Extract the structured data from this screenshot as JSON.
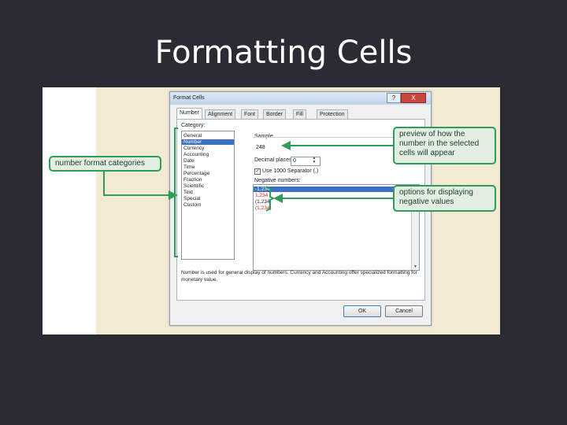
{
  "slide": {
    "title": "Formatting Cells"
  },
  "dialog": {
    "title": "Format Cells",
    "help_glyph": "?",
    "close_glyph": "X",
    "tabs": [
      "Number",
      "Alignment",
      "Font",
      "Border",
      "Fill",
      "Protection"
    ],
    "active_tab": "Number",
    "category_label": "Category:",
    "categories": [
      "General",
      "Number",
      "Currency",
      "Accounting",
      "Date",
      "Time",
      "Percentage",
      "Fraction",
      "Scientific",
      "Text",
      "Special",
      "Custom"
    ],
    "selected_category": "Number",
    "sample_label": "Sample",
    "sample_value": "248",
    "decimal_label": "Decimal places:",
    "decimal_value": "0",
    "separator_label": "Use 1000 Separator (,)",
    "separator_checked": true,
    "negative_label": "Negative numbers:",
    "negative_numbers": [
      "-1,234",
      "1,234",
      "(1,234)",
      "(1,234)"
    ],
    "negative_selected_index": 0,
    "description": "Number is used for general display of numbers. Currency and Accounting offer specialized formatting for monetary value.",
    "ok_label": "OK",
    "cancel_label": "Cancel"
  },
  "callouts": {
    "categories": "number format categories",
    "preview": "preview of how the number in the selected cells will appear",
    "negative": "options for displaying negative values"
  },
  "colors": {
    "slide_bg": "#2b2b33",
    "callout_border": "#2f9c5a",
    "callout_fill": "#e3eee3",
    "selection": "#3b72c4",
    "negative_red": "#d02020"
  }
}
